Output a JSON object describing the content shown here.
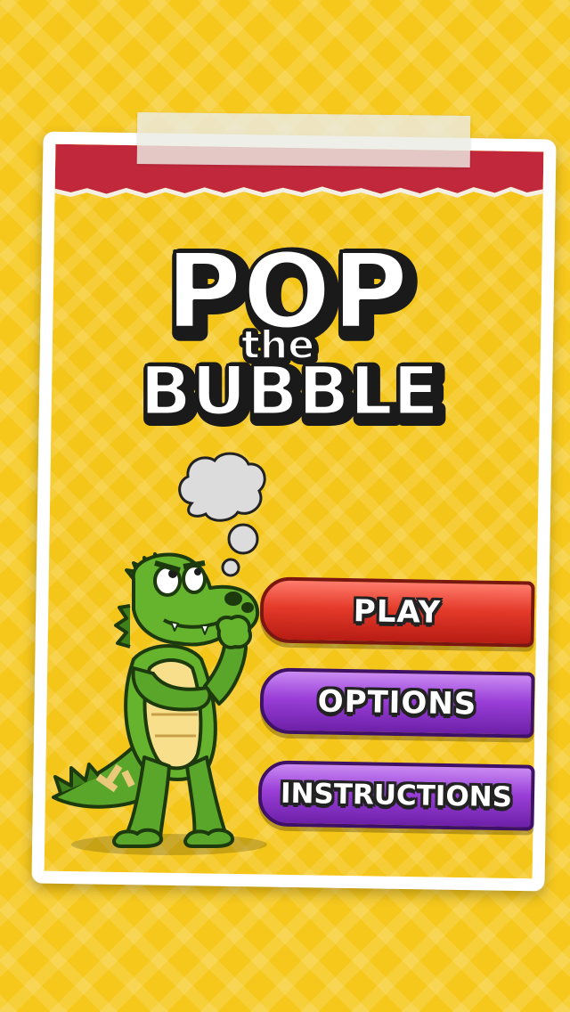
{
  "title": {
    "pop": "POP",
    "the": "the",
    "bubble": "BUBBLE"
  },
  "menu": {
    "play_label": "PLAY",
    "options_label": "OPTIONS",
    "instructions_label": "INSTRUCTIONS"
  },
  "colors": {
    "background": "#f6c81c",
    "card_border": "#ffffff",
    "strip_red": "#c1283c",
    "play_button": "#e43a2a",
    "menu_button": "#9a3fd8",
    "croc_green": "#66b32e",
    "croc_belly": "#f7df8c"
  },
  "icons": {
    "mascot": "crocodile-mascot-icon",
    "thought": "thought-bubble-icon"
  }
}
